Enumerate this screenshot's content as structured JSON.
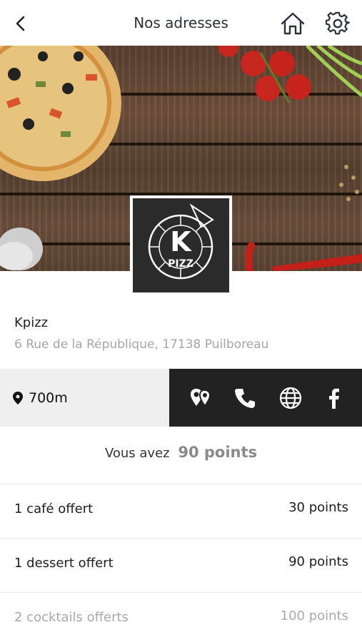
{
  "header": {
    "title": "Nos adresses",
    "back_icon": "chevron-left-icon",
    "home_icon": "home-icon",
    "settings_icon": "gear-icon"
  },
  "logo": {
    "text_top": "K",
    "text_bottom": "PIZZ"
  },
  "store": {
    "name": "Kpizz",
    "address": "6 Rue de la République, 17138 Puilboreau"
  },
  "distance": {
    "icon": "map-pin-icon",
    "value": "700m"
  },
  "actions": [
    {
      "icon": "directions-icon"
    },
    {
      "icon": "phone-icon"
    },
    {
      "icon": "globe-icon"
    },
    {
      "icon": "facebook-icon"
    }
  ],
  "loyalty": {
    "prefix": "Vous avez",
    "points": "90 points"
  },
  "rewards": [
    {
      "label": "1 café offert",
      "points": "30 points",
      "available": true
    },
    {
      "label": "1 dessert offert",
      "points": "90 points",
      "available": true
    },
    {
      "label": "2 cocktails offerts",
      "points": "100 points",
      "available": false
    }
  ],
  "colors": {
    "header_text": "#2a2f3a",
    "action_bar": "#222222",
    "distance_bar": "#efefef",
    "muted": "#a5a5a5"
  }
}
